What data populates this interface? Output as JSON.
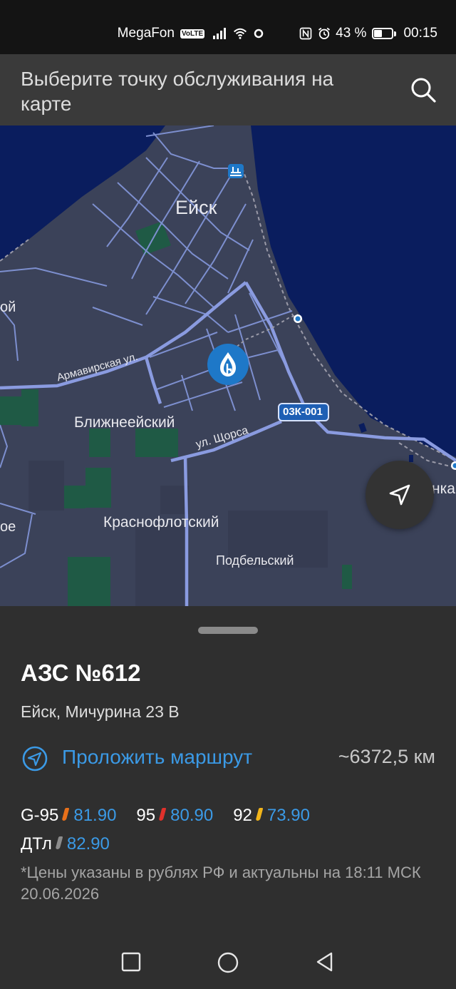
{
  "status_bar": {
    "carrier": "MegaFon",
    "volte": "VoLTE",
    "battery_percent": "43 %",
    "battery_level": 0.43,
    "time": "00:15",
    "icons": [
      "signal-icon",
      "wifi-icon",
      "hotspot-icon",
      "nfc-icon",
      "alarm-icon",
      "battery-icon"
    ]
  },
  "header": {
    "title": "Выберите точку обслуживания на карте",
    "search_icon": "search-icon"
  },
  "map": {
    "labels": {
      "city": "Ейск",
      "left_edge": "ой",
      "street_armavirskaya": "Армавирская ул.",
      "district_blizhneeysky": "Ближнеейский",
      "road_badge": "03К-001",
      "street_shchorsa": "ул. Щорса",
      "right_edge": "нка",
      "left_edge_bottom": "ое",
      "district_krasnoflotsky": "Краснофлотский",
      "district_podbelsky": "Подбельский"
    },
    "colors": {
      "land": "#3b4259",
      "sea": "#0a1d5e",
      "road": "#7d8fcf",
      "road_major": "#8a9be0",
      "green": "#1f5a45",
      "marker": "#1e78c8"
    },
    "gps_icon": "navigation-arrow-icon",
    "marker_icon": "gazprom-flame-icon"
  },
  "station": {
    "title": "АЗС №612",
    "address": "Ейск, Мичурина 23 В",
    "route_label": "Проложить маршрут",
    "distance": "~6372,5 км",
    "fuels": [
      {
        "name": "G-95",
        "price": "81.90",
        "drop_color": "#e8701a"
      },
      {
        "name": "95",
        "price": "80.90",
        "drop_color": "#e0312b"
      },
      {
        "name": "92",
        "price": "73.90",
        "drop_color": "#f2b51a"
      },
      {
        "name": "ДТл",
        "price": "82.90",
        "drop_color": "#8c8c8c"
      }
    ],
    "note": "*Цены указаны в рублях РФ и актуальны на 18:11 МСК 20.06.2026"
  },
  "nav_bar": {
    "icons": [
      "recent-apps-icon",
      "home-icon",
      "back-icon"
    ]
  },
  "accent_color": "#3b9ae6"
}
